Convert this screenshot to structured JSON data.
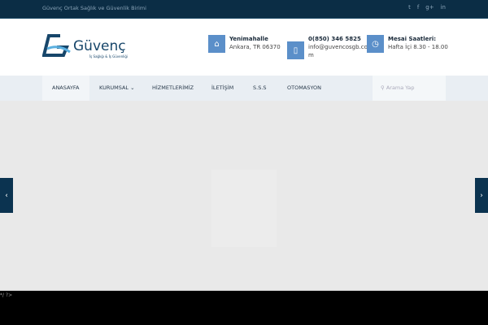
{
  "topbar": {
    "tagline": "Güvenç Ortak Sağlık ve Güvenlik Birimi",
    "social": [
      "twitter-icon",
      "facebook-icon",
      "google-plus-icon",
      "linkedin-icon"
    ],
    "social_glyphs": [
      "🐦",
      "f",
      "g+",
      "in"
    ]
  },
  "logo": {
    "name": "Güvenç",
    "subtitle": "İş Sağlığı & İş Güvenliği"
  },
  "info": [
    {
      "icon": "home-icon",
      "title": "Yenimahalle",
      "line1": "Ankara, TR 06370"
    },
    {
      "icon": "phone-icon",
      "title": "0(850) 346 5825",
      "line1": "info@guvencosgb.co",
      "line2": "m"
    },
    {
      "icon": "clock-icon",
      "title": "Mesai Saatleri:",
      "line1": "Hafta İçi 8.30 - 18.00"
    }
  ],
  "nav": {
    "items": [
      "ANASAYFA",
      "KURUMSAL ⌄",
      "HİZMETLERİMİZ",
      "İLETİŞİM",
      "S.S.S",
      "OTOMASYON"
    ],
    "search_placeholder": "Arama Yap"
  },
  "slider": {
    "prev": "‹",
    "next": "›"
  },
  "footer": {
    "code": "*/ ?>"
  },
  "colors": {
    "topbar": "#0b2d45",
    "accent": "#5b8fc9"
  }
}
